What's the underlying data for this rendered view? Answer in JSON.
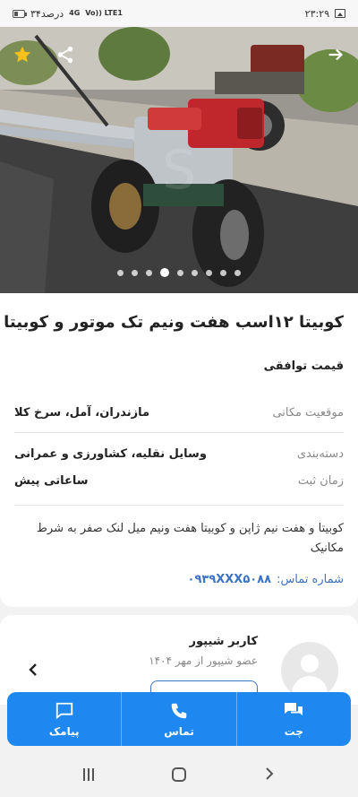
{
  "status_bar": {
    "time": "۲۳:۲۹",
    "battery_text": "۳۴درصد",
    "network_top": "4G",
    "network_lte": "Vo)) LTE1"
  },
  "hero": {
    "slides_count": 9,
    "active_slide": 4
  },
  "listing": {
    "title": "کوبیتا ۱۲اسب هفت ونیم تک موتور و کوبیتا",
    "price": "قیمت توافقی",
    "details": [
      {
        "key": "موقعیت مکانی",
        "value": "مازندران، آمل، سرخ کلا"
      },
      {
        "key": "دسته‌بندی",
        "value": "وسایل نقلیه، کشاورزی و عمرانی"
      },
      {
        "key": "زمان ثبت",
        "value": "ساعاتی پیش"
      }
    ],
    "description": "کوبیتا و هفت نیم ژاپن و کوبیتا هفت ونیم میل لنک صفر به شرط مکانیک",
    "phone_label": "شماره تماس:",
    "phone_number": "۰۹۳۹XXX۵۰۸۸"
  },
  "seller": {
    "name": "کاربر شیپور",
    "member_since": "عضو شیپور از مهر ۱۴۰۴"
  },
  "actions": {
    "chat": "چت",
    "call": "تماس",
    "sms": "پیامک"
  },
  "colors": {
    "accent": "#1e88f0",
    "link": "#3d73c2"
  }
}
